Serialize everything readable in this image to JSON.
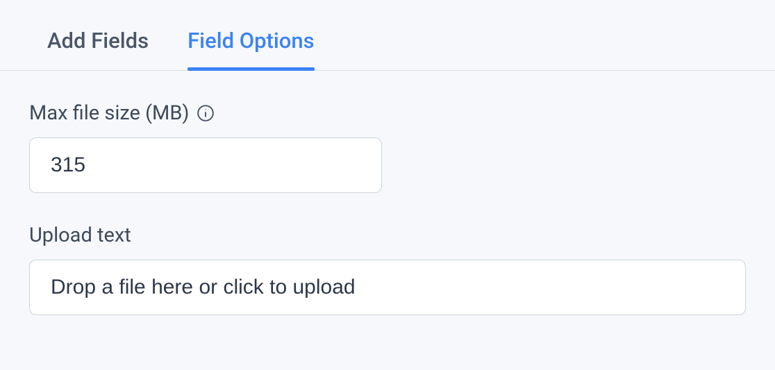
{
  "tabs": {
    "add_fields": "Add Fields",
    "field_options": "Field Options"
  },
  "fields": {
    "max_file_size": {
      "label": "Max file size (MB)",
      "value": "315"
    },
    "upload_text": {
      "label": "Upload text",
      "value": "Drop a file here or click to upload"
    }
  }
}
